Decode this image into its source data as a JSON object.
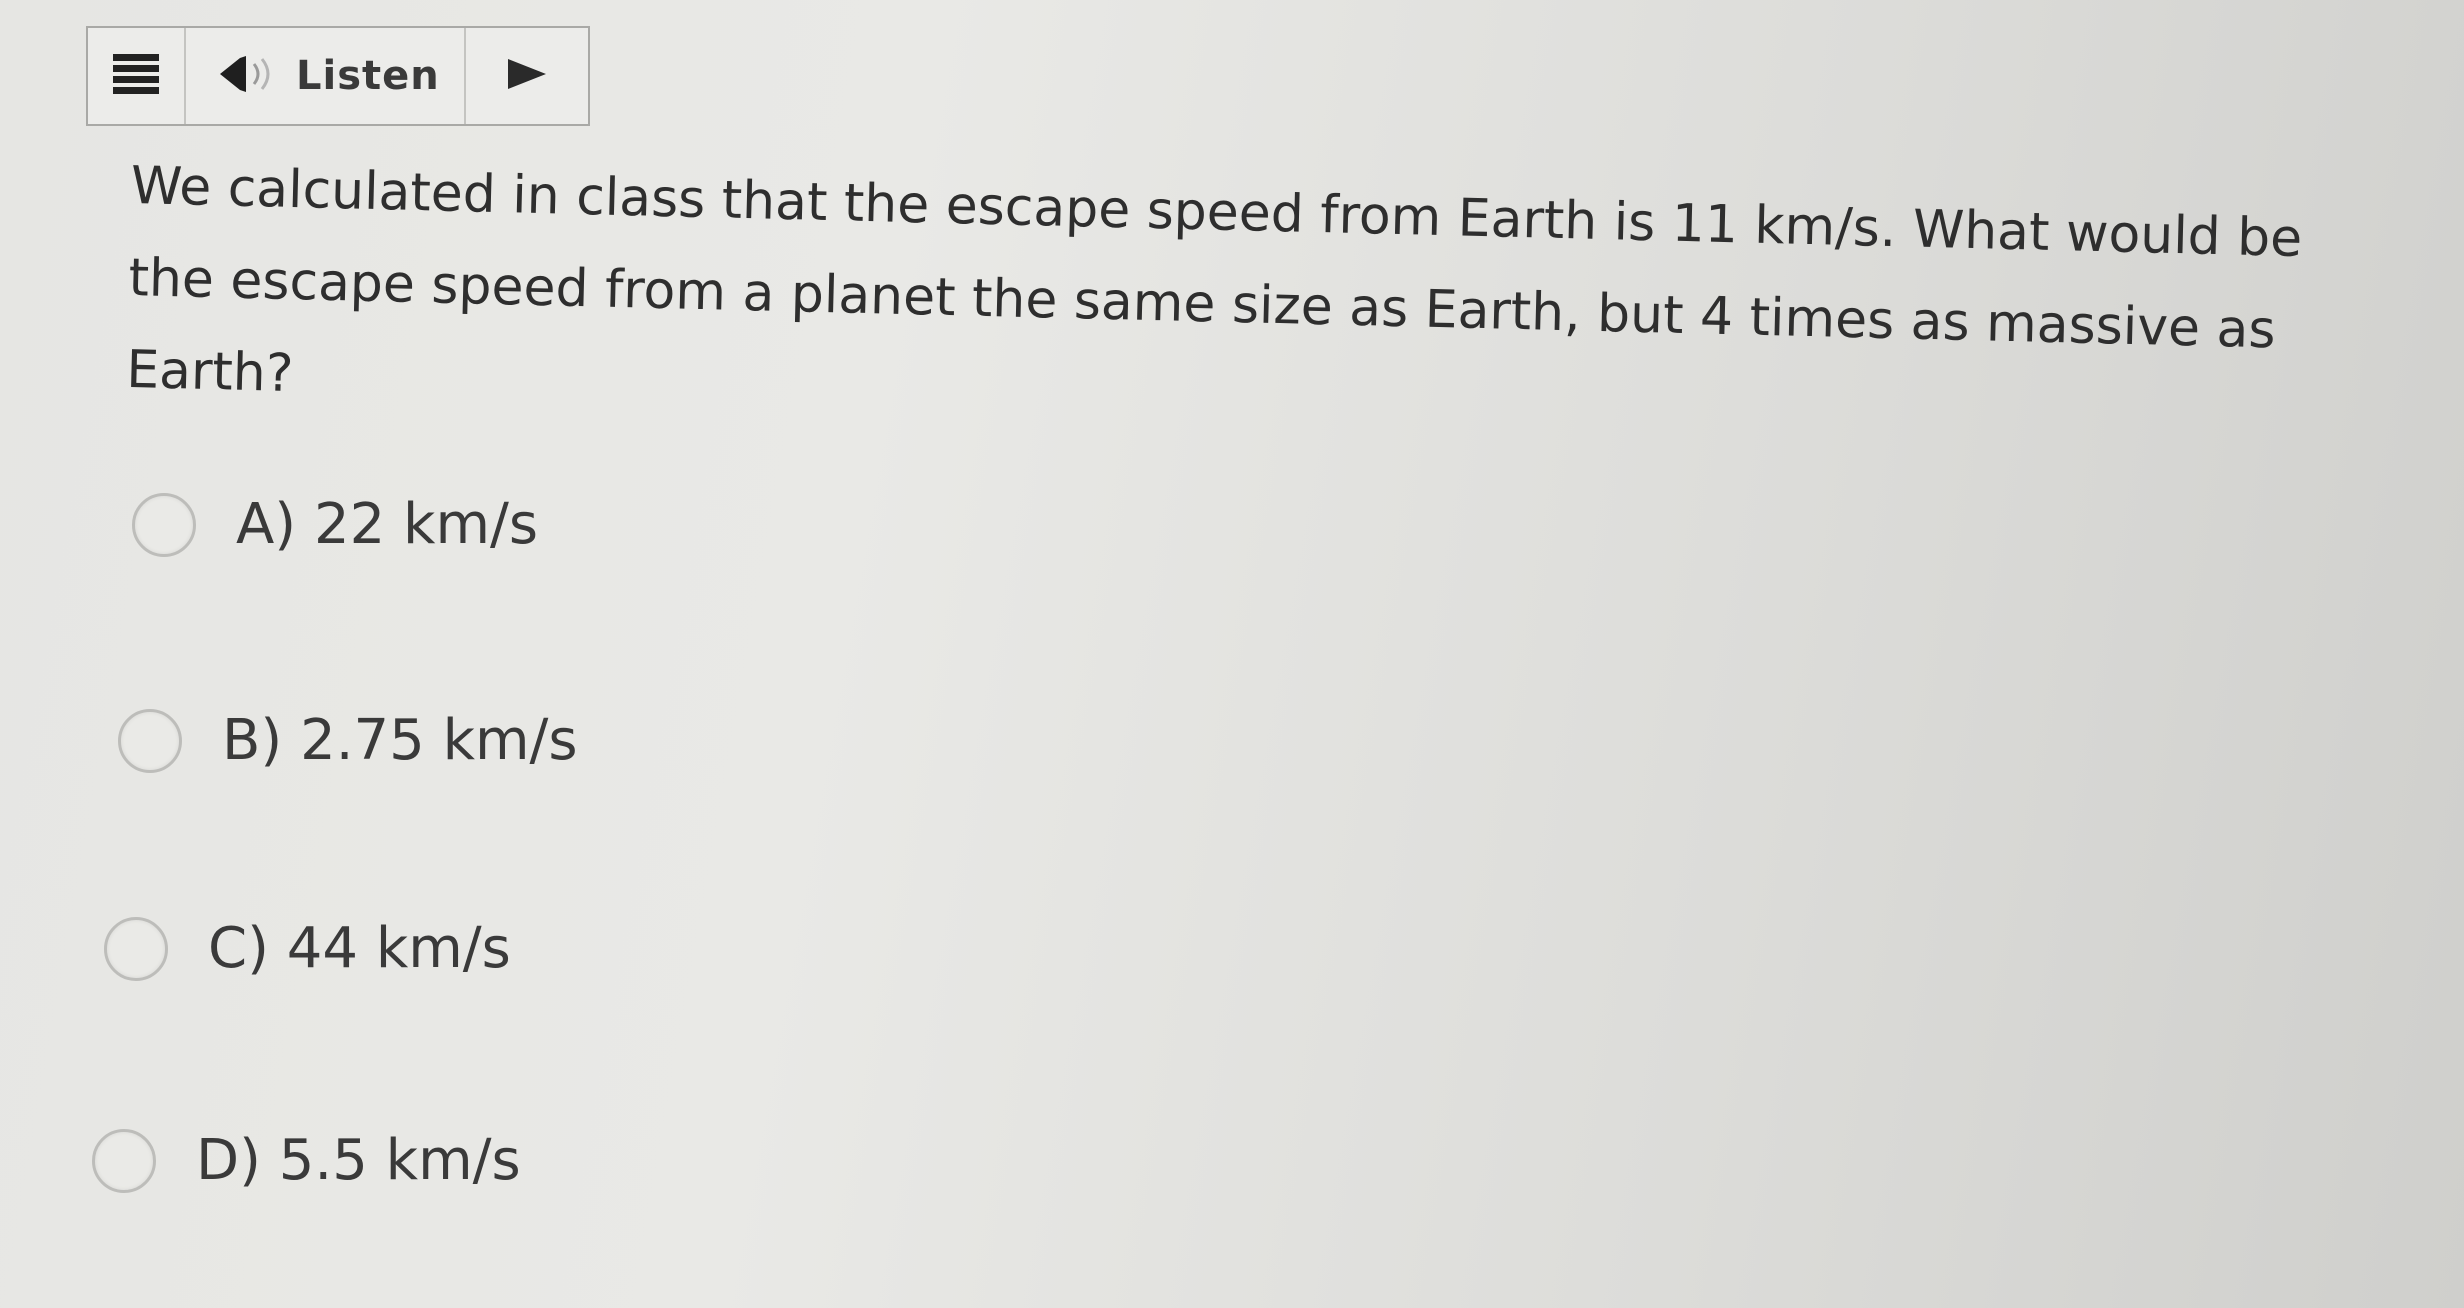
{
  "toolbar": {
    "menu_icon": "hamburger-icon",
    "speaker_icon": "speaker-icon",
    "listen_label": "Listen",
    "play_icon": "play-icon"
  },
  "question": {
    "text": "We calculated in class that the escape speed from Earth is 11 km/s.  What would be the escape speed from a planet the same size as Earth, but 4 times as massive as Earth?"
  },
  "options": [
    {
      "letter": "A)",
      "value": "22 km/s"
    },
    {
      "letter": "B)",
      "value": "2.75 km/s"
    },
    {
      "letter": "C)",
      "value": "44 km/s"
    },
    {
      "letter": "D)",
      "value": "5.5 km/s"
    }
  ],
  "colors": {
    "text": "#2e2e2e",
    "toolbar_border": "#a9a9a6"
  }
}
